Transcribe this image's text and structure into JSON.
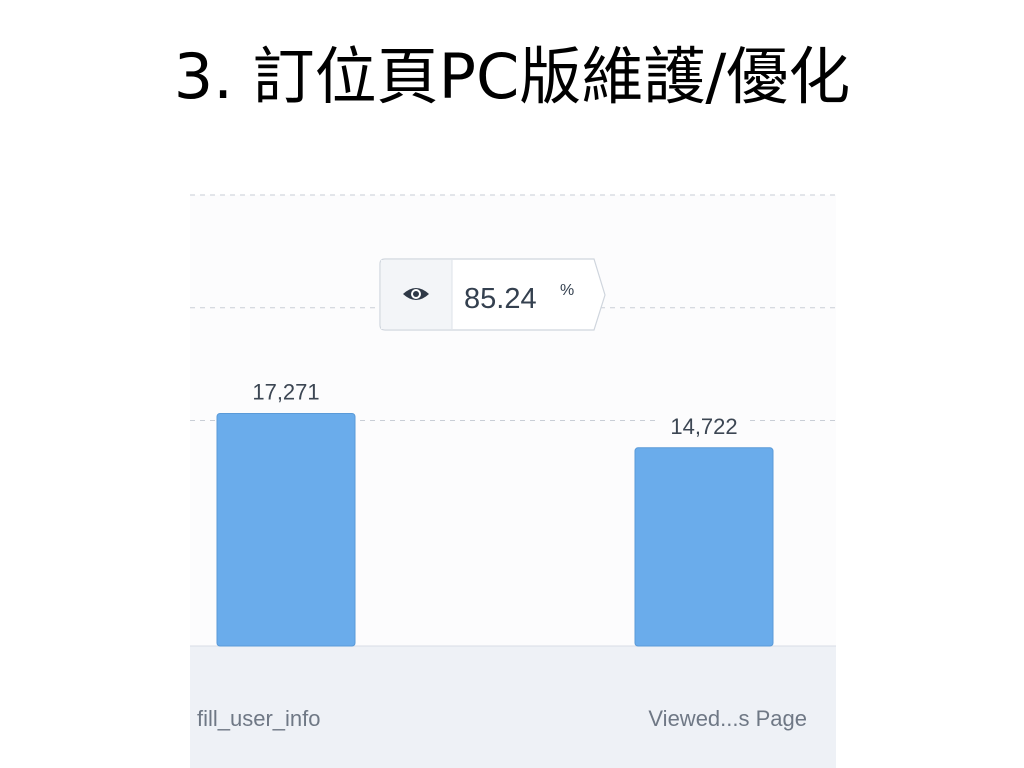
{
  "slide": {
    "title": "3. 訂位頁PC版維護/優化"
  },
  "conversion": {
    "icon": "eye-icon",
    "value": "85.24",
    "unit": "%"
  },
  "colors": {
    "bar": "#6aaceb",
    "bar_border": "#5a9ad8",
    "axis_band": "#eef1f6",
    "grid": "#c9ced6",
    "label_text": "#3c4653",
    "tick_text": "#6f7885",
    "tooltip_border": "#cfd5dd",
    "tooltip_icon_bg": "#f3f5f8",
    "tooltip_text": "#34404f"
  },
  "chart_data": {
    "type": "bar",
    "categories": [
      "fill_user_info",
      "Viewed...s Page"
    ],
    "values": [
      17271,
      14722
    ],
    "value_labels": [
      "17,271",
      "14,722"
    ],
    "title": "",
    "xlabel": "",
    "ylabel": "",
    "ylim": [
      0,
      33500
    ],
    "grid": true,
    "gridlines": [
      16750,
      25125,
      33500
    ]
  }
}
